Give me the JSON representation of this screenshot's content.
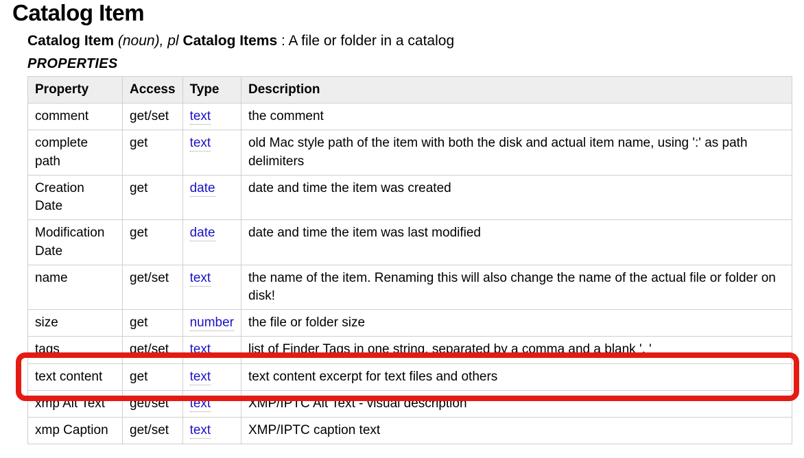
{
  "heading": "Catalog Item",
  "definition": {
    "term": "Catalog Item",
    "pos": "(noun), pl",
    "plural": "Catalog Items",
    "body": ": A file or folder in a catalog"
  },
  "section_label": "PROPERTIES",
  "columns": {
    "property": "Property",
    "access": "Access",
    "type": "Type",
    "description": "Description"
  },
  "rows": [
    {
      "property": "comment",
      "access": "get/set",
      "type": "text",
      "description": "the comment"
    },
    {
      "property": "complete path",
      "access": "get",
      "type": "text",
      "description": "old Mac style path of the item with both the disk and actual item name, using ':' as path delimiters"
    },
    {
      "property": "Creation Date",
      "access": "get",
      "type": "date",
      "description": "date and time the item was created"
    },
    {
      "property": "Modification Date",
      "access": "get",
      "type": "date",
      "description": "date and time the item was last modified"
    },
    {
      "property": "name",
      "access": "get/set",
      "type": "text",
      "description": "the name of the item. Renaming this will also change the name of the actual file or folder on disk!"
    },
    {
      "property": "size",
      "access": "get",
      "type": "number",
      "description": "the file or folder size"
    },
    {
      "property": "tags",
      "access": "get/set",
      "type": "text",
      "description": "list of Finder Tags in one string, separated by a comma and a blank ', '"
    },
    {
      "property": "text content",
      "access": "get",
      "type": "text",
      "description": "text content excerpt for text files and others"
    },
    {
      "property": "xmp Alt Text",
      "access": "get/set",
      "type": "text",
      "description": "XMP/IPTC Alt Text - visual description"
    },
    {
      "property": "xmp Caption",
      "access": "get/set",
      "type": "text",
      "description": "XMP/IPTC caption text"
    }
  ],
  "highlighted_row_index": 7
}
